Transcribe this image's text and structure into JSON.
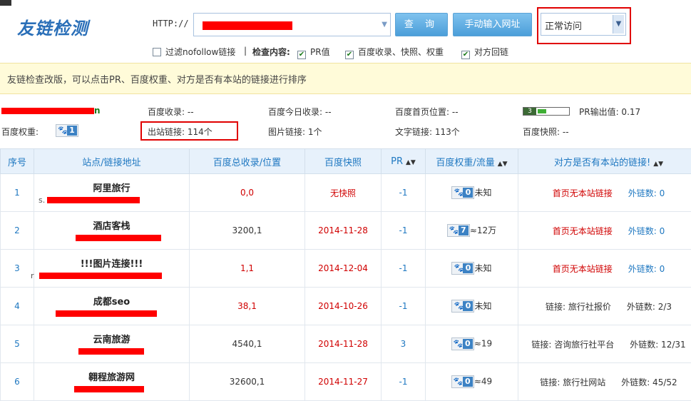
{
  "header": {
    "logo": "友链检测",
    "http_label": "HTTP://",
    "query_button": "查 询",
    "manual_button": "手动输入网址",
    "access_mode": "正常访问"
  },
  "options": {
    "filter_nofollow": "过滤nofollow链接",
    "separator": "|",
    "check_label": "检查内容:",
    "pr": "PR值",
    "baidu": "百度收录、快照、权重",
    "backlink": "对方回链"
  },
  "notice": "友链检查改版，可以点击PR、百度权重、对方是否有本站的链接进行排序",
  "stats": {
    "domain_tail": "n",
    "baidu_index": "百度收录: --",
    "baidu_today": "百度今日收录: --",
    "baidu_home": "百度首页位置: --",
    "pr_out": "PR输出值: 0.17",
    "pr_badge": "3",
    "baidu_weight_label": "百度权重:",
    "baidu_weight": "1",
    "out_links": "出站链接: 114个",
    "image_links": "图片链接: 1个",
    "text_links": "文字链接: 113个",
    "baidu_snapshot": "百度快照: --"
  },
  "table": {
    "headers": [
      "序号",
      "站点/链接地址",
      "百度总收录/位置",
      "百度快照",
      "PR",
      "百度权重/流量",
      "对方是否有本站的链接!"
    ],
    "rows": [
      {
        "idx": "1",
        "name": "阿里旅行",
        "url_prefix": "s.",
        "index": "0,0",
        "snapshot": "无快照",
        "pr": "-1",
        "weight": "0",
        "traffic": "未知",
        "link": "首页无本站链接",
        "out": "外链数: 0"
      },
      {
        "idx": "2",
        "name": "酒店客栈",
        "url_prefix": "",
        "index": "3200,1",
        "snapshot": "2014-11-28",
        "pr": "-1",
        "weight": "7",
        "traffic": "≈12万",
        "link": "首页无本站链接",
        "out": "外链数: 0"
      },
      {
        "idx": "3",
        "name": "!!!图片连接!!!",
        "url_prefix": "r",
        "index": "1,1",
        "snapshot": "2014-12-04",
        "pr": "-1",
        "weight": "0",
        "traffic": "未知",
        "link": "首页无本站链接",
        "out": "外链数: 0"
      },
      {
        "idx": "4",
        "name": "成都seo",
        "url_prefix": "",
        "index": "38,1",
        "snapshot": "2014-10-26",
        "pr": "-1",
        "weight": "0",
        "traffic": "未知",
        "link": "链接: 旅行社报价",
        "out": "外链数: 2/3"
      },
      {
        "idx": "5",
        "name": "云南旅游",
        "url_prefix": "",
        "index": "4540,1",
        "snapshot": "2014-11-28",
        "pr": "3",
        "weight": "0",
        "traffic": "≈19",
        "link": "链接: 咨询旅行社平台",
        "out": "外链数: 12/31"
      },
      {
        "idx": "6",
        "name": "翱程旅游网",
        "url_prefix": "",
        "index": "32600,1",
        "snapshot": "2014-11-27",
        "pr": "-1",
        "weight": "0",
        "traffic": "≈49",
        "link": "链接: 旅行社网站",
        "out": "外链数: 45/52"
      }
    ]
  }
}
